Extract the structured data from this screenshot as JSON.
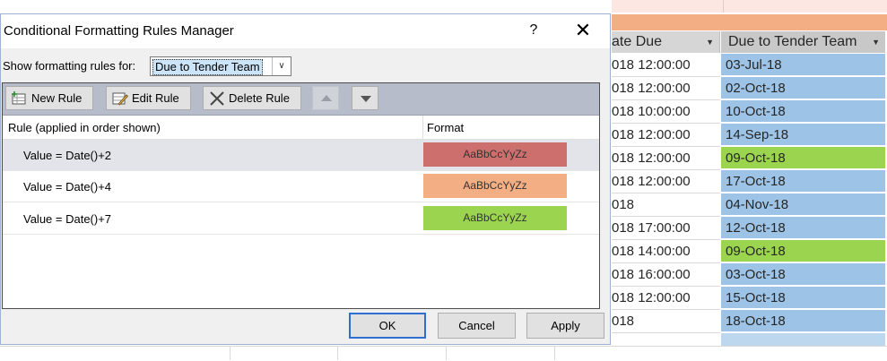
{
  "spreadsheet": {
    "col1_header": "ate Due",
    "col2_header": "Due to Tender Team",
    "rows": [
      {
        "c1": "018 12:00:00",
        "c2": "03-Jul-18",
        "c2_color": "#9dc3e6"
      },
      {
        "c1": "018 12:00:00",
        "c2": "02-Oct-18",
        "c2_color": "#9dc3e6"
      },
      {
        "c1": "018 10:00:00",
        "c2": "10-Oct-18",
        "c2_color": "#9dc3e6"
      },
      {
        "c1": "018 12:00:00",
        "c2": "14-Sep-18",
        "c2_color": "#9dc3e6"
      },
      {
        "c1": "018 12:00:00",
        "c2": "09-Oct-18",
        "c2_color": "#9bd44f"
      },
      {
        "c1": "018 12:00:00",
        "c2": "17-Oct-18",
        "c2_color": "#9dc3e6"
      },
      {
        "c1": "018",
        "c2": "04-Nov-18",
        "c2_color": "#9dc3e6"
      },
      {
        "c1": "018 17:00:00",
        "c2": "12-Oct-18",
        "c2_color": "#9dc3e6"
      },
      {
        "c1": "018 14:00:00",
        "c2": "09-Oct-18",
        "c2_color": "#9bd44f"
      },
      {
        "c1": "018 16:00:00",
        "c2": "03-Oct-18",
        "c2_color": "#9dc3e6"
      },
      {
        "c1": "018 12:00:00",
        "c2": "15-Oct-18",
        "c2_color": "#9dc3e6"
      },
      {
        "c1": "018",
        "c2": "18-Oct-18",
        "c2_color": "#9dc3e6"
      },
      {
        "c1": "",
        "c2": "",
        "c2_color": "#bdd7ee"
      }
    ]
  },
  "dialog": {
    "title": "Conditional Formatting Rules Manager",
    "help_glyph": "?",
    "close_glyph": "✕",
    "show_label": "Show formatting rules for:",
    "show_value": "Due to Tender Team",
    "toolbar": {
      "new_rule": "New Rule",
      "edit_rule": "Edit Rule",
      "delete_rule": "Delete Rule"
    },
    "columns": {
      "rule": "Rule (applied in order shown)",
      "format": "Format"
    },
    "rules": [
      {
        "text": "Value = Date()+2",
        "preview": "AaBbCcYyZz",
        "color": "#cd6f6c"
      },
      {
        "text": "Value = Date()+4",
        "preview": "AaBbCcYyZz",
        "color": "#f4ae84"
      },
      {
        "text": "Value = Date()+7",
        "preview": "AaBbCcYyZz",
        "color": "#9bd44f"
      }
    ],
    "buttons": {
      "ok": "OK",
      "cancel": "Cancel",
      "apply": "Apply"
    }
  }
}
